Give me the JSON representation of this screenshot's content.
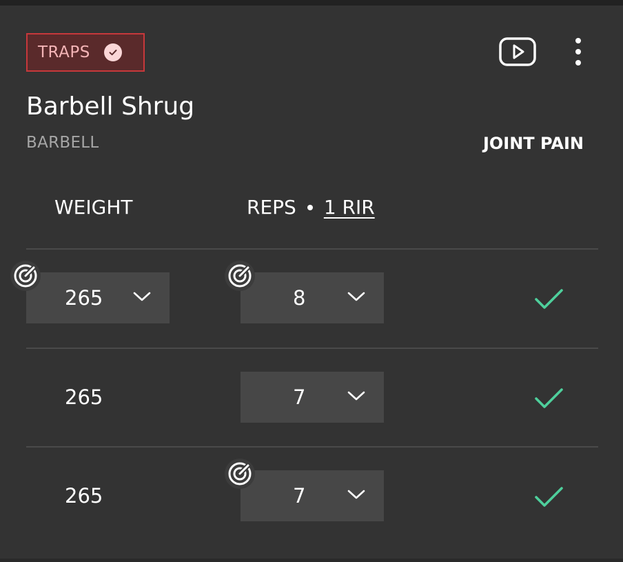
{
  "header": {
    "muscle_group": "TRAPS",
    "title": "Barbell Shrug",
    "equipment": "BARBELL",
    "joint_pain_label": "JOINT PAIN"
  },
  "columns": {
    "weight": "WEIGHT",
    "reps": "REPS",
    "rir": "1 RIR"
  },
  "sets": [
    {
      "weight": "265",
      "reps": "8",
      "weight_dropdown": true,
      "reps_dropdown": true,
      "weight_target_icon": true,
      "reps_target_icon": true,
      "completed": true
    },
    {
      "weight": "265",
      "reps": "7",
      "weight_dropdown": false,
      "reps_dropdown": true,
      "weight_target_icon": false,
      "reps_target_icon": false,
      "completed": true
    },
    {
      "weight": "265",
      "reps": "7",
      "weight_dropdown": false,
      "reps_dropdown": true,
      "weight_target_icon": false,
      "reps_target_icon": true,
      "completed": true
    }
  ],
  "icons": {
    "badge": "check-circle-icon",
    "video": "play-video-icon",
    "menu": "more-vertical-icon",
    "target": "target-icon",
    "dropdown": "chevron-down-icon",
    "done": "checkmark-icon"
  },
  "colors": {
    "background": "#333333",
    "badge_border": "#c7383b",
    "badge_bg": "#5a2a2b",
    "badge_text": "#f3b4b6",
    "field_bg": "#474747",
    "check_green": "#4ecf9c",
    "muted_text": "#a6a6a6"
  }
}
